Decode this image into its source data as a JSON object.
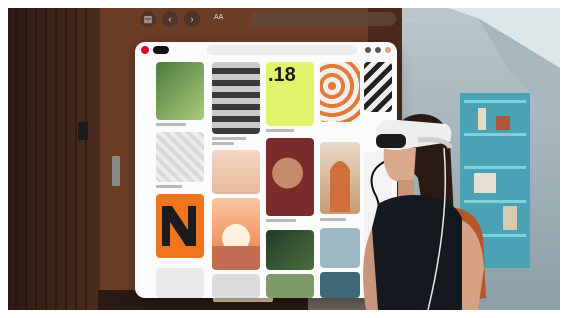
{
  "window": {
    "address": "",
    "text_size_label": "AA",
    "tabs": {
      "home": "",
      "today": "",
      "create": ""
    },
    "search_placeholder": "",
    "tiles": {
      "number_tile": ".18"
    }
  },
  "colors": {
    "accent": "#e60023",
    "lime": "#e1f26b",
    "orange": "#f1741e",
    "wood": "#6b3d26",
    "teal_shelves": "#5fb8c9"
  },
  "icons": [
    "back-icon",
    "forward-icon",
    "tabs-icon",
    "pinterest-logo-icon",
    "search-icon",
    "share-icon",
    "add-icon"
  ]
}
